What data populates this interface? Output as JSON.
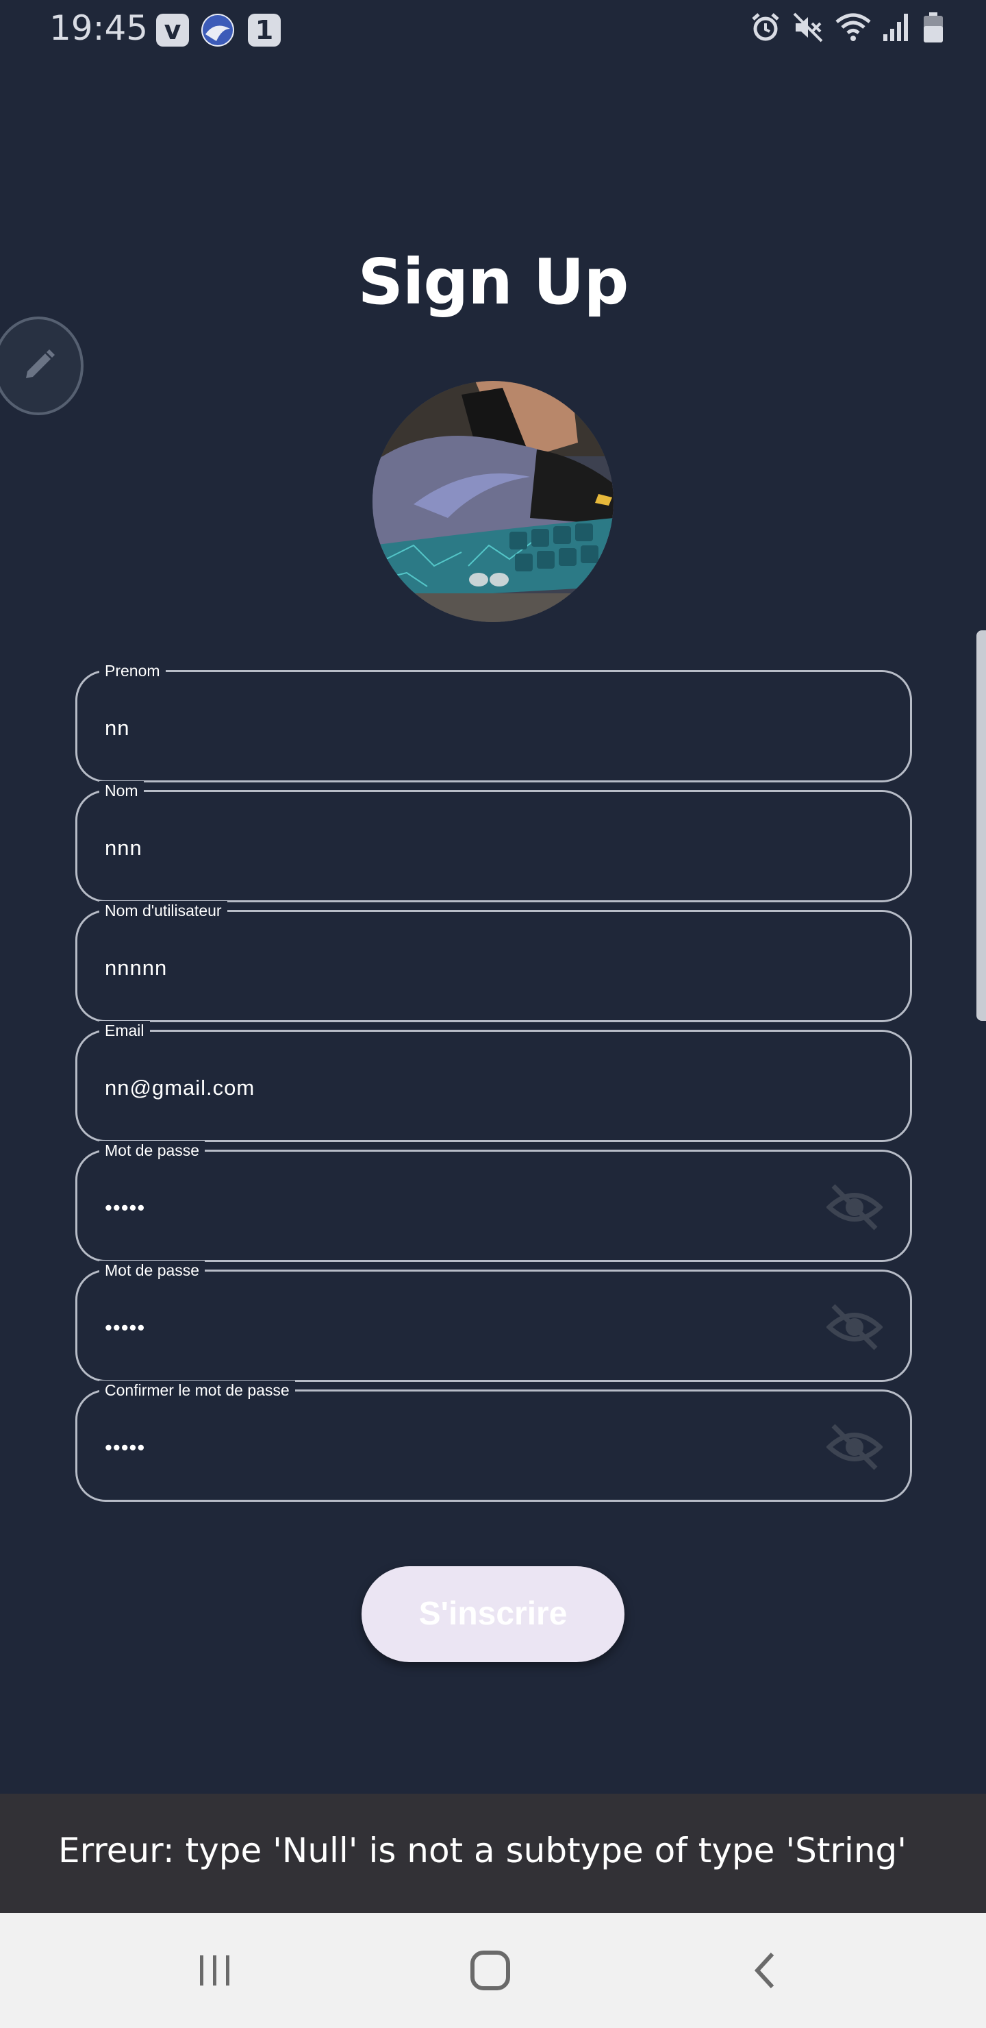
{
  "status_bar": {
    "time": "19:45",
    "app_icons": [
      "v-app-icon",
      "browser-app-icon",
      "one-app-icon"
    ],
    "right_icons": [
      "alarm-icon",
      "mute-icon",
      "wifi-icon",
      "signal-icon",
      "battery-icon"
    ]
  },
  "page": {
    "title": "Sign Up"
  },
  "form": {
    "fields": [
      {
        "label": "Prenom",
        "value": "nn"
      },
      {
        "label": "Nom",
        "value": "nnn"
      },
      {
        "label": "Nom d'utilisateur",
        "value": "nnnnn"
      },
      {
        "label": "Email",
        "value": "nn@gmail.com"
      },
      {
        "label": "Mot de passe",
        "value": "•••••",
        "icon": "visibility-off-icon"
      },
      {
        "label": "Mot de passe",
        "value": "•••••",
        "icon": "visibility-off-icon"
      },
      {
        "label": "Confirmer le mot de passe",
        "value": "•••••",
        "icon": "visibility-off-icon"
      }
    ],
    "submit_label": "S'inscrire"
  },
  "snackbar": {
    "message": "Erreur: type 'Null' is not a subtype of type 'String'"
  },
  "nav": {
    "buttons": [
      "recents-icon",
      "home-icon",
      "back-icon"
    ]
  },
  "colors": {
    "background": "#1f2739",
    "button_bg": "#ebe5f3",
    "snackbar_bg": "#323136",
    "nav_bg": "#f1f1f1",
    "field_border": "#b7bcc7"
  }
}
